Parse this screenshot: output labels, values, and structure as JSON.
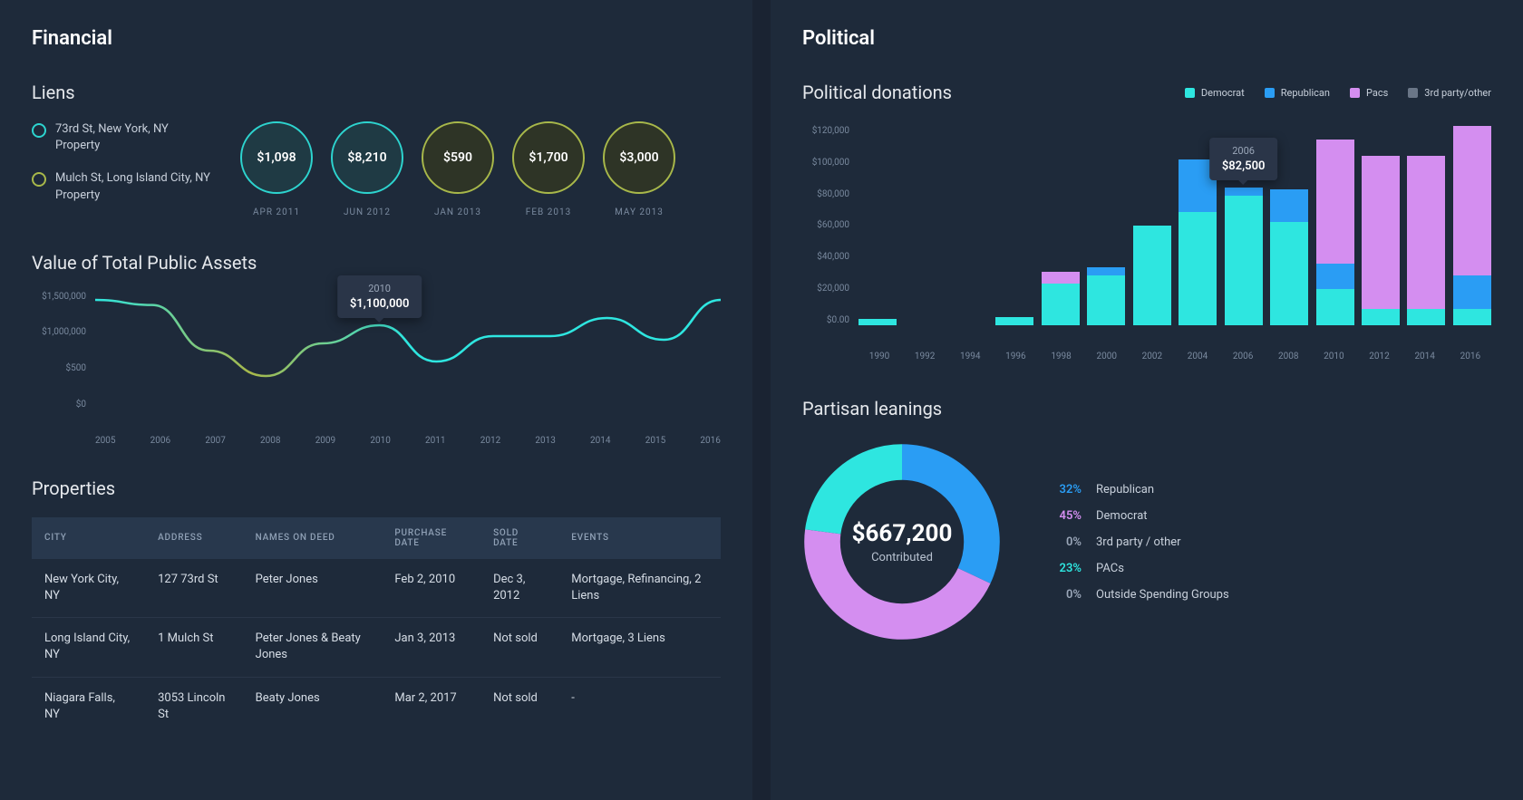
{
  "financial": {
    "title": "Financial",
    "liens": {
      "title": "Liens",
      "properties": [
        {
          "label": "73rd St, New York, NY Property",
          "color": "teal"
        },
        {
          "label": "Mulch St, Long Island City, NY Property",
          "color": "olive"
        }
      ],
      "bubbles": [
        {
          "value": "$1,098",
          "date": "APR 2011",
          "color": "teal"
        },
        {
          "value": "$8,210",
          "date": "JUN 2012",
          "color": "teal"
        },
        {
          "value": "$590",
          "date": "JAN 2013",
          "color": "olive"
        },
        {
          "value": "$1,700",
          "date": "FEB 2013",
          "color": "olive"
        },
        {
          "value": "$3,000",
          "date": "MAY 2013",
          "color": "olive"
        }
      ]
    },
    "assets": {
      "title": "Value of Total Public Assets",
      "tooltip": {
        "year": "2010",
        "value": "$1,100,000"
      }
    },
    "properties": {
      "title": "Properties",
      "columns": [
        "CITY",
        "ADDRESS",
        "NAMES ON DEED",
        "PURCHASE DATE",
        "SOLD DATE",
        "EVENTS"
      ],
      "rows": [
        {
          "city": "New York City, NY",
          "address": "127 73rd St",
          "names": "Peter Jones",
          "purchase": "Feb 2, 2010",
          "sold": "Dec 3, 2012",
          "events": "Mortgage, Refinancing, 2 Liens"
        },
        {
          "city": "Long Island City, NY",
          "address": "1 Mulch St",
          "names": "Peter Jones & Beaty Jones",
          "purchase": "Jan 3, 2013",
          "sold": "Not sold",
          "events": "Mortgage, 3 Liens"
        },
        {
          "city": "Niagara Falls, NY",
          "address": "3053 Lincoln St",
          "names": "Beaty Jones",
          "purchase": "Mar 2, 2017",
          "sold": "Not sold",
          "events": "-"
        }
      ]
    }
  },
  "political": {
    "title": "Political",
    "donations": {
      "title": "Political donations",
      "legend": [
        {
          "label": "Democrat",
          "color": "sw-dem"
        },
        {
          "label": "Republican",
          "color": "sw-rep"
        },
        {
          "label": "Pacs",
          "color": "sw-pac"
        },
        {
          "label": "3rd party/other",
          "color": "sw-oth"
        }
      ],
      "tooltip": {
        "year": "2006",
        "value": "$82,500"
      }
    },
    "partisan": {
      "title": "Partisan leanings",
      "total": "$667,200",
      "total_label": "Contributed",
      "breakdown": [
        {
          "pct": "32%",
          "label": "Republican",
          "cls": "rep"
        },
        {
          "pct": "45%",
          "label": "Democrat",
          "cls": "dem"
        },
        {
          "pct": "0%",
          "label": "3rd party / other",
          "cls": "oth"
        },
        {
          "pct": "23%",
          "label": "PACs",
          "cls": "pac"
        },
        {
          "pct": "0%",
          "label": "Outside Spending Groups",
          "cls": "oth"
        }
      ]
    }
  },
  "chart_data": [
    {
      "type": "line",
      "title": "Value of Total Public Assets",
      "xlabel": "",
      "ylabel": "",
      "ylim": [
        0,
        1500000
      ],
      "yticks": [
        0,
        500,
        1000000,
        1500000
      ],
      "ytick_labels": [
        "$0",
        "$500",
        "$1,000,000",
        "$1,500,000"
      ],
      "x": [
        2005,
        2006,
        2007,
        2008,
        2009,
        2010,
        2011,
        2012,
        2013,
        2014,
        2015,
        2016
      ],
      "values": [
        1450000,
        1380000,
        750000,
        400000,
        850000,
        1100000,
        600000,
        950000,
        950000,
        1200000,
        900000,
        1450000
      ],
      "annotation": {
        "x": 2010,
        "y": 1100000,
        "label": "$1,100,000"
      }
    },
    {
      "type": "bar",
      "title": "Political donations",
      "xlabel": "",
      "ylabel": "",
      "ylim": [
        0,
        120000
      ],
      "yticks": [
        0,
        20000,
        40000,
        60000,
        80000,
        100000,
        120000
      ],
      "ytick_labels": [
        "$0.00",
        "$20,000",
        "$40,000",
        "$60,000",
        "$80,000",
        "$100,000",
        "$120,000"
      ],
      "categories": [
        1990,
        1992,
        1994,
        1996,
        1998,
        2000,
        2002,
        2004,
        2006,
        2008,
        2010,
        2012,
        2014,
        2016
      ],
      "series": [
        {
          "name": "Democrat",
          "color": "#2ee6e0",
          "values": [
            4000,
            0,
            0,
            5000,
            25000,
            30000,
            60000,
            68000,
            78000,
            62000,
            22000,
            10000,
            10000,
            10000
          ]
        },
        {
          "name": "Republican",
          "color": "#2a9df4",
          "values": [
            0,
            0,
            0,
            0,
            0,
            5000,
            0,
            32000,
            5000,
            20000,
            15000,
            0,
            0,
            20000
          ]
        },
        {
          "name": "Pacs",
          "color": "#d48ef0",
          "values": [
            0,
            0,
            0,
            0,
            7000,
            0,
            0,
            0,
            0,
            0,
            75000,
            92000,
            92000,
            90000
          ]
        }
      ],
      "annotation": {
        "x": 2006,
        "total": 82500,
        "label": "$82,500"
      }
    },
    {
      "type": "pie",
      "title": "Partisan leanings",
      "total_label": "$667,200 Contributed",
      "series": [
        {
          "name": "Republican",
          "value": 32,
          "color": "#2a9df4"
        },
        {
          "name": "Democrat",
          "value": 45,
          "color": "#d48ef0"
        },
        {
          "name": "3rd party / other",
          "value": 0,
          "color": "#6a7687"
        },
        {
          "name": "PACs",
          "value": 23,
          "color": "#2ee6e0"
        },
        {
          "name": "Outside Spending Groups",
          "value": 0,
          "color": "#6a7687"
        }
      ]
    }
  ]
}
